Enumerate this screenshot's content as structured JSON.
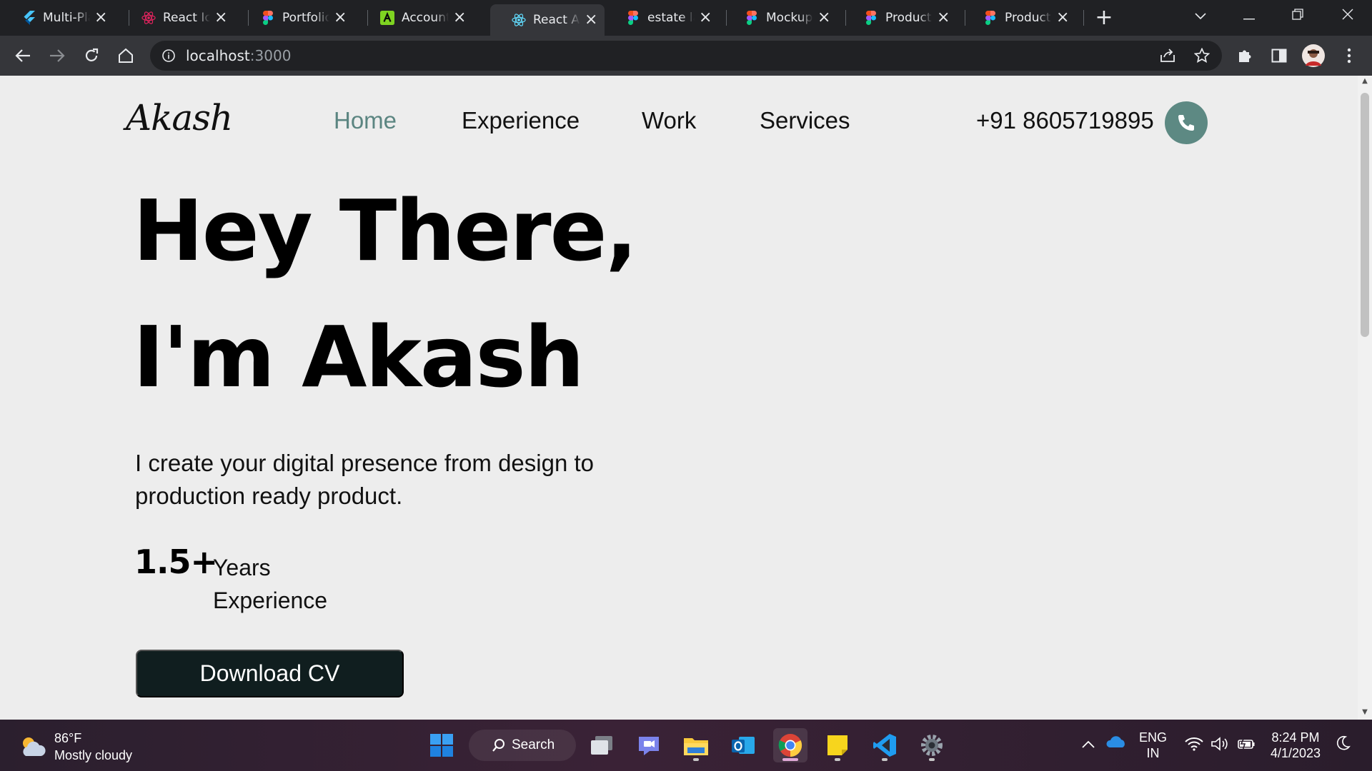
{
  "browser": {
    "tabs": [
      {
        "title": "Multi-Platform",
        "icon": "flutter-icon"
      },
      {
        "title": "React Icons",
        "icon": "react-icon"
      },
      {
        "title": "Portfolio",
        "icon": "figma-icon"
      },
      {
        "title": "Account",
        "icon": "adobe-icon"
      },
      {
        "title": "React App",
        "icon": "react-icon",
        "active": true
      },
      {
        "title": "estate landing",
        "icon": "figma-icon"
      },
      {
        "title": "Mockup",
        "icon": "figma-icon"
      },
      {
        "title": "Product",
        "icon": "figma-icon"
      },
      {
        "title": "Product",
        "icon": "figma-icon"
      }
    ],
    "url_host": "localhost",
    "url_port": ":3000"
  },
  "site": {
    "logo": "Akash",
    "nav": [
      "Home",
      "Experience",
      "Work",
      "Services"
    ],
    "active_nav": "Home",
    "phone": "+91 8605719895",
    "accent_color": "#5d8983"
  },
  "hero": {
    "line1": "Hey There,",
    "line2": "I'm Akash",
    "tagline": "I create your digital presence from design to production ready product.",
    "experience_value": "1.5+",
    "experience_label": "Years Experience",
    "cta": "Download CV"
  },
  "taskbar": {
    "weather_temp": "86°F",
    "weather_desc": "Mostly cloudy",
    "search": "Search",
    "lang_top": "ENG",
    "lang_bottom": "IN",
    "time": "8:24 PM",
    "date": "4/1/2023"
  }
}
